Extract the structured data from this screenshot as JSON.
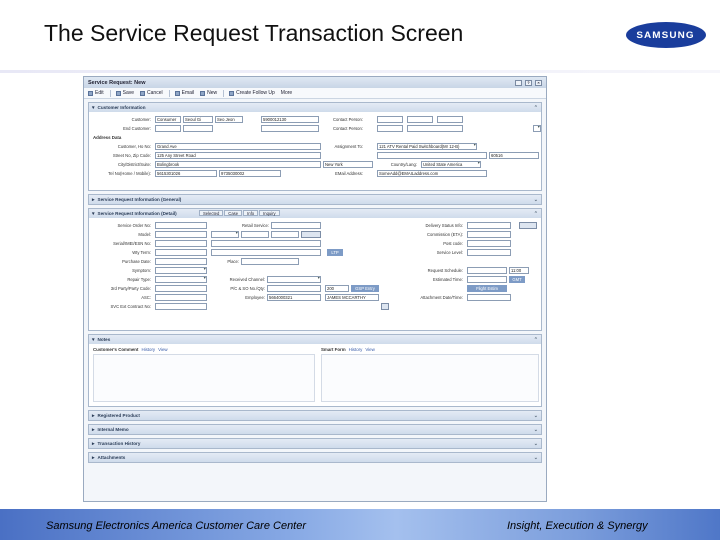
{
  "slide": {
    "title": "The Service Request Transaction Screen",
    "logo_text": "SAMSUNG"
  },
  "footer": {
    "left": "Samsung Electronics America Customer Care Center",
    "right": "Insight, Execution & Synergy"
  },
  "app": {
    "title": "Service Request: New",
    "toolbar": [
      "Edit",
      "Save",
      "Cancel",
      "Email",
      "New",
      "Create Follow Up",
      "More"
    ],
    "customer": {
      "header": "Customer Information",
      "customer_label": "Customer:",
      "customer_value": "Consumer",
      "customer_name": "Seoul Gi",
      "customer_first": "Seo Jeon",
      "customer_id": "5900012130",
      "end_customer_label": "End Customer:",
      "contact_person_label": "Contact Person:",
      "contact_person2_label": "Contact Person:",
      "address_header": "Address Data",
      "address_label": "Customer, Ho No:",
      "address_value": "Grand Ave",
      "street_label": "Street No, Zip Code:",
      "street_value": "125 Any Street Road",
      "city_label": "City/District/Suite:",
      "city_value": "Bolingbrook",
      "tel_label": "Tel No(Home / Mobile):",
      "tel_value": "5615301026",
      "tel2_value": "9735030002",
      "assignment_label": "Assignment To:",
      "assignment_value": "121 ATV Rental Paid Switchboard(Mr 12-B)",
      "zip_value": "60516",
      "state_value": "New York",
      "country_label": "Country/Lang:",
      "country_value": "United State America",
      "email_label": "EMail Address:",
      "email_value": "SomeAdd@EMAILaddress.com"
    },
    "sr_general": {
      "header": "Service Request Information (General)"
    },
    "sr_detail": {
      "header": "Service Request Information (Detail)",
      "tabs": [
        "Selected",
        "Case",
        "Info",
        "Inquiry"
      ],
      "service_order_label": "Service Order No:",
      "retail_label": "Retail Service:",
      "delivery_label": "Delivery Status Info:",
      "model_label": "Model:",
      "serial_label": "Serial/IMEI/ESN No:",
      "warranty_label": "Wty Term:",
      "warranty_value": "LTP",
      "purchase_label": "Purchase Date:",
      "symptom_label": "Symptom:",
      "repair_type_label": "Repair Type:",
      "third_party_label": "3rd Party/Party Code:",
      "asc_label": "ASC:",
      "svc_contract_label": "SVC Ext Contract No:",
      "place_label": "Place:",
      "received_label": "Received Channel:",
      "pic_label": "P/C & SO No./Qty:",
      "pic_value": "200",
      "employee_label": "Employee:",
      "employee_value": "5664000321",
      "employee_name": "JAMES MCCARTHY",
      "gsp_button": "GSP Entry",
      "commission_label": "Commission (ETA):",
      "post_label": "Post code:",
      "service_level_label": "Service Level:",
      "request_label": "Request Schedule:",
      "request_value": "11:00",
      "estimated_label": "Estimated Time:",
      "estimated_value": "GMT",
      "attachment_label": "Attachment Date/Time:",
      "flight_button": "Flight Estim"
    },
    "notes": {
      "header": "Notes",
      "customer_comment": "Customer's Comment",
      "smart_form": "Smart Form",
      "history": "History",
      "view": "View"
    },
    "collapsed": [
      "Registered Product",
      "Internal Memo",
      "Transaction History",
      "Attachments"
    ]
  }
}
